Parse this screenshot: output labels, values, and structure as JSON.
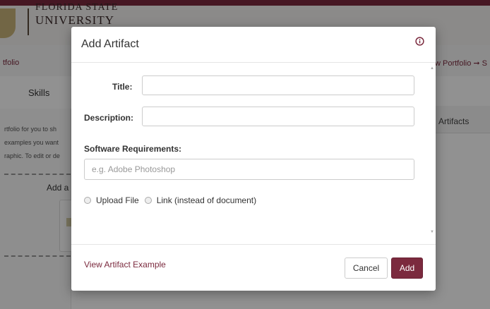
{
  "background": {
    "logo": {
      "line1": "FLORIDA STATE",
      "line2": "UNIVERSITY"
    },
    "breadcrumb_left": "tfolio",
    "breadcrumb_right": "w Portfolio ➞ S",
    "tab_skills": "Skills",
    "description_lines": [
      "rtfolio for you to sh",
      "examples you want",
      "raphic. To edit or de"
    ],
    "add_label": "Add a",
    "artifacts_tab": "Artifacts"
  },
  "modal": {
    "title": "Add Artifact",
    "fields": {
      "title_label": "Title:",
      "title_value": "",
      "description_label": "Description:",
      "description_value": "",
      "software_label": "Software Requirements:",
      "software_placeholder": "e.g. Adobe Photoshop"
    },
    "radios": {
      "upload_file": "Upload File",
      "link": "Link (instead of document)"
    },
    "footer": {
      "example_link": "View Artifact Example",
      "cancel_label": "Cancel",
      "add_label": "Add"
    }
  },
  "colors": {
    "accent": "#7b2a3e",
    "backdrop": "rgba(0,0,0,0.43)"
  }
}
